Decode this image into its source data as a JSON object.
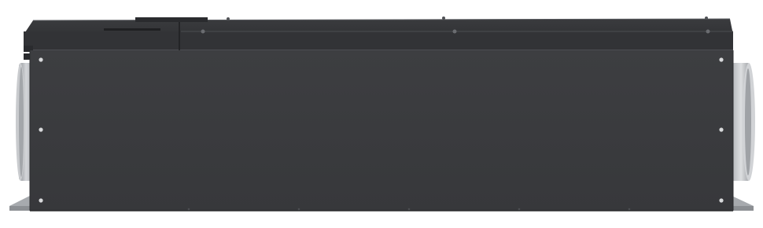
{
  "image": {
    "subject": "ventilation-unit",
    "background_color": "#ffffff",
    "colors": {
      "body": "#3a3b3e",
      "top_panel": "#2f3033",
      "top_edge": "#5a5c60",
      "duct_metal": "#b9bcc0",
      "screw": "#d8d9db",
      "bracket": "#9da0a4"
    }
  }
}
